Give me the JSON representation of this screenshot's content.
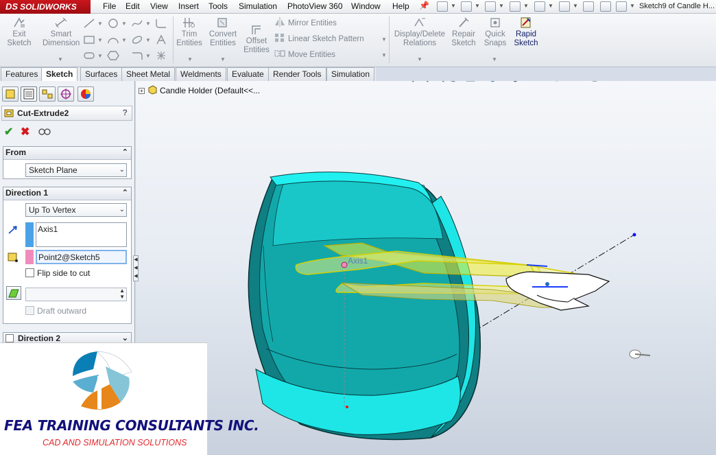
{
  "app": {
    "brand": "SOLIDWORKS",
    "brand_prefix": "DS",
    "document_title": "Sketch9 of Candle H..."
  },
  "menu": {
    "items": [
      "File",
      "Edit",
      "View",
      "Insert",
      "Tools",
      "Simulation",
      "PhotoView 360",
      "Window",
      "Help"
    ]
  },
  "command_manager": {
    "exit_sketch": "Exit Sketch",
    "smart_dimension": "Smart Dimension",
    "trim_entities": "Trim Entities",
    "convert_entities": "Convert Entities",
    "offset_entities": "Offset Entities",
    "mirror_entities": "Mirror Entities",
    "linear_sketch_pattern": "Linear Sketch Pattern",
    "move_entities": "Move Entities",
    "display_delete_relations": "Display/Delete Relations",
    "repair_sketch": "Repair Sketch",
    "quick_snaps": "Quick Snaps",
    "rapid_sketch": "Rapid Sketch"
  },
  "tabs": [
    "Features",
    "Sketch",
    "Surfaces",
    "Sheet Metal",
    "Weldments",
    "Evaluate",
    "Render Tools",
    "Simulation"
  ],
  "active_tab": "Sketch",
  "property_manager": {
    "title": "Cut-Extrude2",
    "help": "?",
    "from": {
      "label": "From",
      "value": "Sketch Plane"
    },
    "direction1": {
      "label": "Direction 1",
      "end_condition": "Up To Vertex",
      "direction_ref": "Axis1",
      "vertex_ref": "Point2@Sketch5",
      "flip_side_label": "Flip side to cut",
      "flip_side_checked": false,
      "draft_label": "Draft outward",
      "draft_checked": false,
      "draft_value": ""
    },
    "direction2": {
      "label": "Direction 2",
      "checked": false
    }
  },
  "feature_tree": {
    "root": "Candle Holder  (Default<<..."
  },
  "viewport": {
    "axis_label": "Axis1",
    "model_color": "#1ee6e6",
    "sketch_color": "#f2ee30"
  },
  "branding": {
    "company": "FEA TRAINING  CONSULTANTS INC.",
    "tagline": "CAD AND SIMULATION SOLUTIONS"
  },
  "colors": {
    "accent_red": "#c9161c",
    "swatch_blue": "#4aa3e8",
    "swatch_pink": "#f08cbc"
  }
}
